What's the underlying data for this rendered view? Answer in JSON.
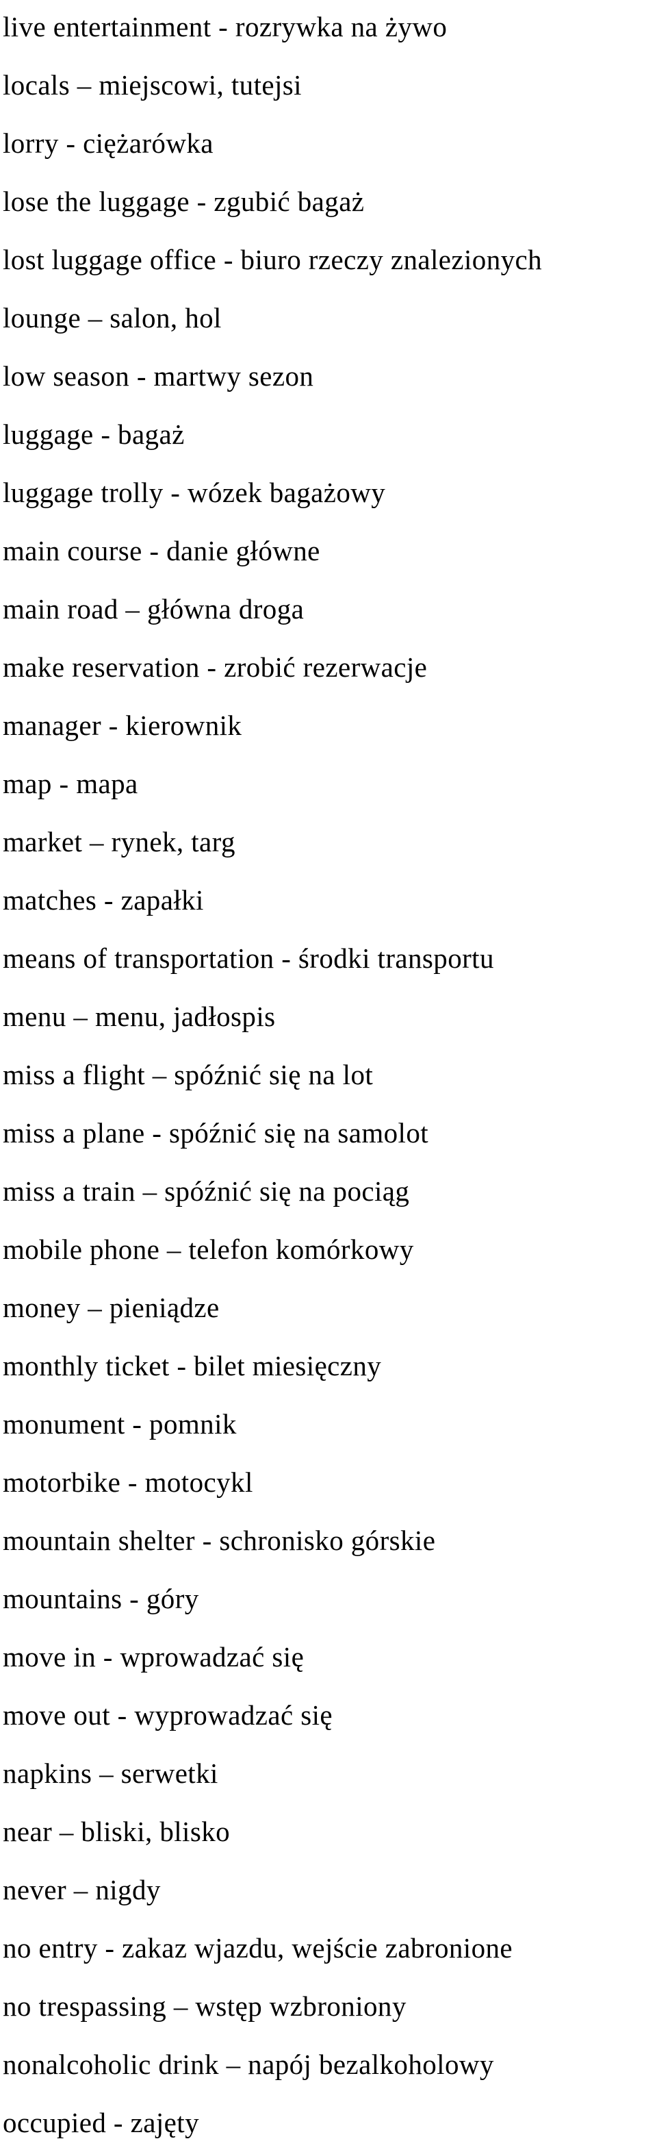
{
  "document": {
    "type": "vocabulary-list",
    "language_pair": "English - Polish",
    "background_color": "#ffffff",
    "text_color": "#000000",
    "line_count": 36,
    "entries": [
      {
        "term": "live entertainment",
        "separator": "-",
        "translation": "rozrywka na żywo",
        "text": "live entertainment - rozrywka na żywo"
      },
      {
        "term": "locals",
        "separator": "–",
        "translation": "miejscowi, tutejsi",
        "text": "locals – miejscowi, tutejsi"
      },
      {
        "term": "lorry",
        "separator": "-",
        "translation": "ciężarówka",
        "text": "lorry - ciężarówka"
      },
      {
        "term": "lose the luggage",
        "separator": "-",
        "translation": "zgubić bagaż",
        "text": "lose the luggage - zgubić bagaż"
      },
      {
        "term": "lost luggage office",
        "separator": "-",
        "translation": "biuro rzeczy znalezionych",
        "text": "lost luggage office - biuro rzeczy znalezionych"
      },
      {
        "term": "lounge",
        "separator": "–",
        "translation": "salon, hol",
        "text": "lounge – salon, hol"
      },
      {
        "term": "low season",
        "separator": "-",
        "translation": "martwy sezon",
        "text": "low season - martwy sezon"
      },
      {
        "term": "luggage",
        "separator": "-",
        "translation": "bagaż",
        "text": "luggage - bagaż"
      },
      {
        "term": "luggage trolly",
        "separator": "-",
        "translation": "wózek bagażowy",
        "text": "luggage trolly - wózek bagażowy"
      },
      {
        "term": "main course",
        "separator": "-",
        "translation": "danie główne",
        "text": "main course - danie główne"
      },
      {
        "term": "main road",
        "separator": "–",
        "translation": "główna droga",
        "text": "main road – główna droga"
      },
      {
        "term": "make reservation",
        "separator": "-",
        "translation": "zrobić rezerwacje",
        "text": "make reservation - zrobić rezerwacje"
      },
      {
        "term": "manager",
        "separator": "-",
        "translation": "kierownik",
        "text": "manager - kierownik"
      },
      {
        "term": "map",
        "separator": "-",
        "translation": "mapa",
        "text": "map - mapa"
      },
      {
        "term": "market",
        "separator": "–",
        "translation": "rynek, targ",
        "text": "market – rynek, targ"
      },
      {
        "term": "matches",
        "separator": "-",
        "translation": "zapałki",
        "text": "matches - zapałki"
      },
      {
        "term": "means of transportation",
        "separator": "-",
        "translation": "środki transportu",
        "text": "means of transportation - środki transportu"
      },
      {
        "term": "menu",
        "separator": "–",
        "translation": "menu, jadłospis",
        "text": "menu – menu, jadłospis"
      },
      {
        "term": "miss a flight",
        "separator": "–",
        "translation": "spóźnić się na lot",
        "text": "miss a flight – spóźnić się na lot"
      },
      {
        "term": "miss a plane",
        "separator": "-",
        "translation": "spóźnić się na samolot",
        "text": "miss a plane - spóźnić się na samolot"
      },
      {
        "term": "miss a train",
        "separator": "–",
        "translation": "spóźnić się na pociąg",
        "text": "miss a train – spóźnić się na pociąg"
      },
      {
        "term": "mobile phone",
        "separator": "–",
        "translation": "telefon komórkowy",
        "text": "mobile phone – telefon komórkowy"
      },
      {
        "term": "money",
        "separator": "–",
        "translation": "pieniądze",
        "text": "money – pieniądze"
      },
      {
        "term": "monthly ticket",
        "separator": "-",
        "translation": "bilet miesięczny",
        "text": "monthly ticket - bilet miesięczny"
      },
      {
        "term": "monument",
        "separator": "-",
        "translation": "pomnik",
        "text": "monument - pomnik"
      },
      {
        "term": "motorbike",
        "separator": "-",
        "translation": "motocykl",
        "text": "motorbike - motocykl"
      },
      {
        "term": "mountain shelter",
        "separator": "-",
        "translation": "schronisko górskie",
        "text": "mountain shelter - schronisko górskie"
      },
      {
        "term": "mountains",
        "separator": "-",
        "translation": "góry",
        "text": "mountains - góry"
      },
      {
        "term": "move in",
        "separator": "-",
        "translation": "wprowadzać się",
        "text": "move in - wprowadzać się"
      },
      {
        "term": "move out",
        "separator": "-",
        "translation": "wyprowadzać się",
        "text": "move out - wyprowadzać się"
      },
      {
        "term": "napkins",
        "separator": "–",
        "translation": "serwetki",
        "text": "napkins – serwetki"
      },
      {
        "term": "near",
        "separator": "–",
        "translation": "bliski, blisko",
        "text": "near – bliski, blisko"
      },
      {
        "term": "never",
        "separator": "–",
        "translation": "nigdy",
        "text": "never – nigdy"
      },
      {
        "term": "no entry",
        "separator": "-",
        "translation": "zakaz wjazdu, wejście zabronione",
        "text": "no entry - zakaz wjazdu, wejście zabronione"
      },
      {
        "term": "no trespassing",
        "separator": "–",
        "translation": "wstęp wzbroniony",
        "text": "no trespassing – wstęp wzbroniony"
      },
      {
        "term": "nonalcoholic drink",
        "separator": "–",
        "translation": "napój bezalkoholowy",
        "text": "nonalcoholic drink – napój bezalkoholowy"
      },
      {
        "term": "occupied",
        "separator": "-",
        "translation": "zajęty",
        "text": "occupied - zajęty"
      }
    ]
  }
}
